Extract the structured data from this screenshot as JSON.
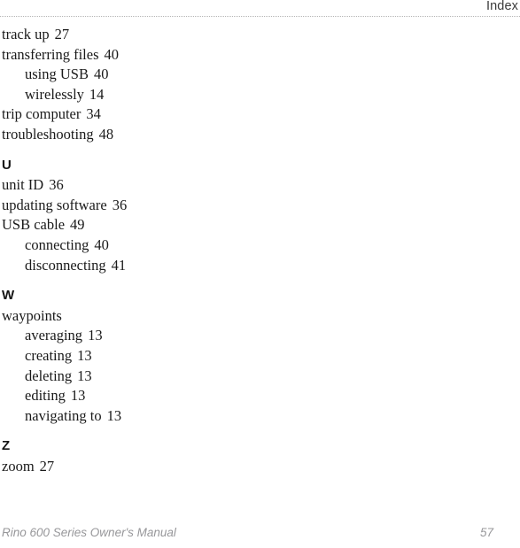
{
  "header": {
    "title": "Index"
  },
  "footer": {
    "book_title": "Rino 600 Series Owner's Manual",
    "page_number": "57"
  },
  "colors": {
    "body_text": "#1a1a1a",
    "header_text": "#3a3a3a",
    "footer_text": "#97979a",
    "rule": "#b4b4b4",
    "background": "#ffffff"
  },
  "index": {
    "blocks": [
      {
        "type": "entries",
        "entries": [
          {
            "level": 1,
            "term": "track up",
            "page": "27"
          },
          {
            "level": 1,
            "term": "transferring files",
            "page": "40"
          },
          {
            "level": 2,
            "term": "using USB",
            "page": "40"
          },
          {
            "level": 2,
            "term": "wirelessly",
            "page": "14"
          },
          {
            "level": 1,
            "term": "trip computer",
            "page": "34"
          },
          {
            "level": 1,
            "term": "troubleshooting",
            "page": "48"
          }
        ]
      },
      {
        "type": "section",
        "letter": "U",
        "entries": [
          {
            "level": 1,
            "term": "unit ID",
            "page": "36"
          },
          {
            "level": 1,
            "term": "updating software",
            "page": "36"
          },
          {
            "level": 1,
            "term": "USB cable",
            "page": "49"
          },
          {
            "level": 2,
            "term": "connecting",
            "page": "40"
          },
          {
            "level": 2,
            "term": "disconnecting",
            "page": "41"
          }
        ]
      },
      {
        "type": "section",
        "letter": "W",
        "entries": [
          {
            "level": 1,
            "term": "waypoints",
            "page": ""
          },
          {
            "level": 2,
            "term": "averaging",
            "page": "13"
          },
          {
            "level": 2,
            "term": "creating",
            "page": "13"
          },
          {
            "level": 2,
            "term": "deleting",
            "page": "13"
          },
          {
            "level": 2,
            "term": "editing",
            "page": "13"
          },
          {
            "level": 2,
            "term": "navigating to",
            "page": "13"
          }
        ]
      },
      {
        "type": "section",
        "letter": "Z",
        "entries": [
          {
            "level": 1,
            "term": "zoom",
            "page": "27"
          }
        ]
      }
    ]
  }
}
